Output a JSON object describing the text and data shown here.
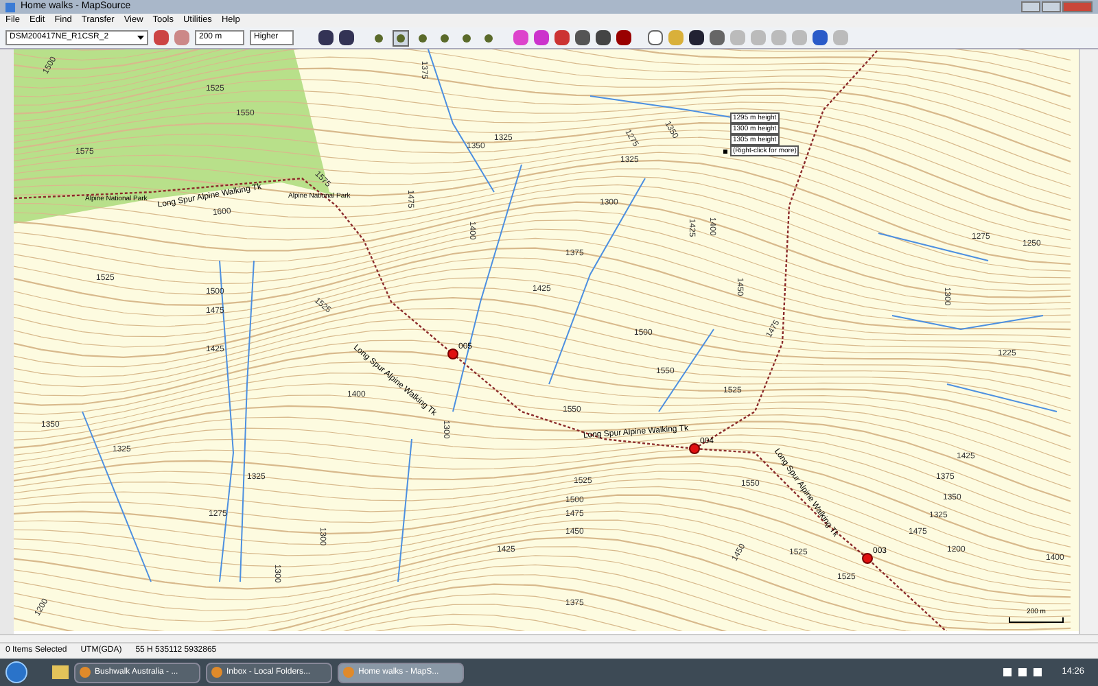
{
  "window": {
    "title": "Home walks - MapSource"
  },
  "menu": [
    "File",
    "Edit",
    "Find",
    "Transfer",
    "View",
    "Tools",
    "Utilities",
    "Help"
  ],
  "toolbar": {
    "map_product": "DSM200417NE_R1CSR_2",
    "zoom": "200 m",
    "detail": "Higher",
    "tools": [
      {
        "selected": false
      },
      {
        "selected": true
      },
      {
        "selected": false
      },
      {
        "selected": false
      },
      {
        "selected": false
      },
      {
        "selected": false
      }
    ]
  },
  "map": {
    "park_labels": [
      "Alpine National Park",
      "Alpine National Park"
    ],
    "track_labels": [
      "Long Spur Alpine Walking Tk",
      "Long Spur Alpine Walking Tk",
      "Long Spur Alpine Walking Tk",
      "Long Spur Alpine Walking Tk"
    ],
    "waypoints": [
      {
        "name": "005"
      },
      {
        "name": "004"
      },
      {
        "name": "003"
      }
    ],
    "contour_labels": [
      "1500",
      "1525",
      "1550",
      "1575",
      "1600",
      "1575",
      "1525",
      "1500",
      "1475",
      "1425",
      "1525",
      "1400",
      "1350",
      "1325",
      "1300",
      "1325",
      "1275",
      "1300",
      "1300",
      "1200",
      "1375",
      "1325",
      "1350",
      "1475",
      "1400",
      "1375",
      "1425",
      "1300",
      "1275",
      "1350",
      "1325",
      "1425",
      "1400",
      "1450",
      "1500",
      "1550",
      "1525",
      "1550",
      "1525",
      "1500",
      "1475",
      "1450",
      "1425",
      "1375",
      "1450",
      "1475",
      "1550",
      "1525",
      "1525",
      "1275",
      "1250",
      "1300",
      "1225",
      "1425",
      "1375",
      "1350",
      "1325",
      "1475",
      "1400",
      "1200"
    ],
    "tooltip": [
      "1295 m height",
      "1300 m height",
      "1305 m height",
      "(Right-click for more)"
    ],
    "scale": "200 m"
  },
  "status_bar": [
    "0 Items Selected",
    "UTM(GDA)",
    "55 H 535112 5932865"
  ],
  "taskbar": {
    "tasks": [
      {
        "label": "Bushwalk Australia - ...",
        "selected": false
      },
      {
        "label": "Inbox - Local Folders...",
        "selected": false
      },
      {
        "label": "Home walks - MapS...",
        "selected": true
      }
    ],
    "clock": "14:26"
  }
}
